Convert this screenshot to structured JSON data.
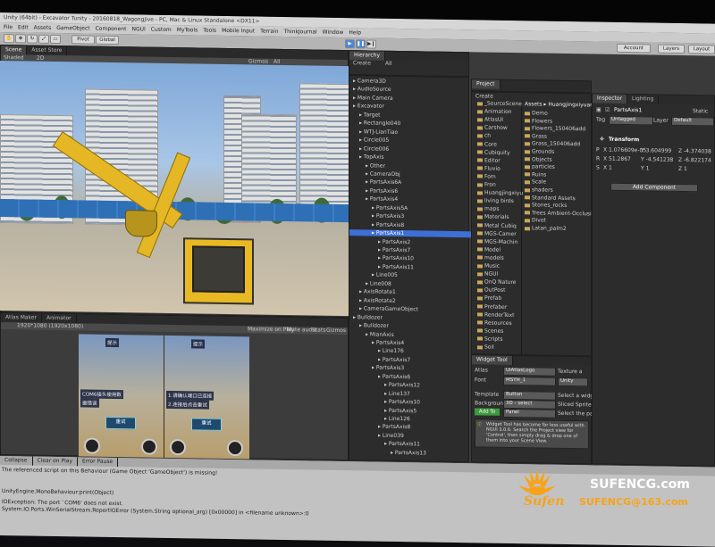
{
  "window": {
    "title": "Unity (64bit) - Excavator Tunity - 20160818_Wagongjive - PC, Mac & Linux Standalone <DX11>"
  },
  "menu": [
    "File",
    "Edit",
    "Assets",
    "GameObject",
    "Component",
    "NGUI",
    "Custom",
    "MyTools",
    "Tools",
    "Mobile Input",
    "Terrain",
    "ThinkJournal",
    "Window",
    "Help"
  ],
  "toolbar": {
    "pivot": "Pivot",
    "global": "Global",
    "account": "Account",
    "layers": "Layers",
    "layout": "Layout"
  },
  "scene_panel": {
    "tabs": [
      "Scene",
      "Asset Store"
    ],
    "shading": "Shaded",
    "mode_2d": "2D",
    "gizmos": "Gizmos",
    "search": "All"
  },
  "game_panel": {
    "tabs": [
      "Atlas Maker",
      "Animator"
    ],
    "resolution": "1920*1080 (1920x1080)",
    "toggles": [
      "Maximize on Play",
      "Mute audio",
      "Stats",
      "Gizmos"
    ],
    "screens": [
      {
        "sign": "提示",
        "retry": "重试",
        "note1": "COM6接头使用数",
        "note2": "据错误"
      },
      {
        "sign": "提示",
        "retry": "重试",
        "note1": "1.请确认端口已连接",
        "note2": "2.连接后点击重试"
      }
    ]
  },
  "console": {
    "buttons": [
      "Collapse",
      "Clear on Play",
      "Error Pause"
    ],
    "lines": [
      "The referenced script on this Behaviour (Game Object 'GameObject') is missing!",
      "UnityEngine.MonoBehaviour:print(Object)",
      "IOException: The port `COM6' does not exist.",
      "System.IO.Ports.WinSerialStream.ReportIOError (System.String optional_arg) [0x00000] in <filename unknown>:0"
    ]
  },
  "hierarchy": {
    "title": "Hierarchy",
    "create": "Create",
    "search": "All",
    "items": [
      {
        "label": "Camera3D",
        "depth": 0
      },
      {
        "label": "AudioSource",
        "depth": 0
      },
      {
        "label": "Main Camera",
        "depth": 0
      },
      {
        "label": "Excavator",
        "depth": 0
      },
      {
        "label": "Target",
        "depth": 1
      },
      {
        "label": "Rectangle040",
        "depth": 1
      },
      {
        "label": "WTJ-LianTiao",
        "depth": 1
      },
      {
        "label": "Circle005",
        "depth": 1
      },
      {
        "label": "Circle006",
        "depth": 1
      },
      {
        "label": "TopAxis",
        "depth": 1
      },
      {
        "label": "Other",
        "depth": 2
      },
      {
        "label": "CameraObj",
        "depth": 2
      },
      {
        "label": "PartsAxis6A",
        "depth": 2
      },
      {
        "label": "PartsAxis6",
        "depth": 2
      },
      {
        "label": "PartsAxis4",
        "depth": 2
      },
      {
        "label": "PartsAxis5A",
        "depth": 3
      },
      {
        "label": "PartsAxis3",
        "depth": 3
      },
      {
        "label": "PartsAxis8",
        "depth": 3
      },
      {
        "label": "PartsAxis1",
        "depth": 3,
        "selected": true
      },
      {
        "label": "PartsAxis2",
        "depth": 4
      },
      {
        "label": "PartsAxis7",
        "depth": 4
      },
      {
        "label": "PartsAxis10",
        "depth": 4
      },
      {
        "label": "PartsAxis11",
        "depth": 4
      },
      {
        "label": "Line005",
        "depth": 3
      },
      {
        "label": "Line008",
        "depth": 2
      },
      {
        "label": "AxisRotate1",
        "depth": 1
      },
      {
        "label": "AxisRotate2",
        "depth": 1
      },
      {
        "label": "CameraGameObject",
        "depth": 1
      },
      {
        "label": "Bulldozer",
        "depth": 0
      },
      {
        "label": "Bulldozer",
        "depth": 1
      },
      {
        "label": "MianAxis",
        "depth": 2
      },
      {
        "label": "PartsAxis4",
        "depth": 3
      },
      {
        "label": "Line176",
        "depth": 4
      },
      {
        "label": "PartsAxis7",
        "depth": 4
      },
      {
        "label": "PartsAxis3",
        "depth": 3
      },
      {
        "label": "PartsAxis6",
        "depth": 4
      },
      {
        "label": "PartsAxis12",
        "depth": 5
      },
      {
        "label": "Line137",
        "depth": 5
      },
      {
        "label": "PartsAxis10",
        "depth": 5
      },
      {
        "label": "PartsAxis5",
        "depth": 5
      },
      {
        "label": "Line126",
        "depth": 5
      },
      {
        "label": "PartsAxis8",
        "depth": 4
      },
      {
        "label": "Line039",
        "depth": 4
      },
      {
        "label": "PartsAxis11",
        "depth": 5
      },
      {
        "label": "PartsAxis13",
        "depth": 6
      }
    ]
  },
  "project": {
    "title": "Project",
    "create": "Create",
    "breadcrumb": "Assets ▸ Huangjingxiyuanba",
    "folders": [
      "_SourceScene",
      "Animation",
      "AtlasUI",
      "Carshow",
      "ch",
      "Core",
      "Cubiquity",
      "Editor",
      "Fluvio",
      "Fom",
      "Fron",
      "Huangjingxiyu",
      "living birds",
      "maps",
      "Materials",
      "Metal Cubiq",
      "MGS-Camer",
      "MGS-Machin",
      "Model",
      "models",
      "Music",
      "NGUI",
      "OnQ Nature",
      "OutPost",
      "Prefab",
      "Prefaber",
      "RenderText",
      "Resources",
      "Scenes",
      "Scripts",
      "Soil"
    ],
    "assets": [
      "Demo",
      "Flowers",
      "Flowers_150406add",
      "Grass",
      "Grass_150406add",
      "Grounds",
      "Objects",
      "particles",
      "Ruins",
      "Scale",
      "shaders",
      "Standard Assets",
      "Stones_rocks",
      "Trees Ambient-Occlusion",
      "Divot",
      "Latan_palm2"
    ]
  },
  "widget_tool": {
    "title": "Widget Tool",
    "atlas_label": "Atlas",
    "atlas_value": "UiAtlasLogo",
    "font_label": "Font",
    "font_value": "MSYH_1",
    "template_label": "Template",
    "template_value": "Button",
    "background_label": "Background",
    "background_value": "3D - select",
    "add_to": "Add To",
    "panel": "Panel",
    "texture_label": "Texture a",
    "unity_label": "Unity",
    "select_widget": "Select a widge",
    "sliced_sprite": "Sliced Sprite fo",
    "select_panel": "Select the par",
    "info": "Widget Tool has become far less useful with NGUI 3.0.6. Search the Project view for 'Control', then simply drag & drop one of them into your Scene View."
  },
  "inspector": {
    "tabs": [
      "Inspector",
      "Lighting"
    ],
    "object_name": "PartsAxis1",
    "static": "Static",
    "tag_label": "Tag",
    "tag_value": "Untagged",
    "layer_label": "Layer",
    "layer_value": "Default",
    "component": "Transform",
    "rows": [
      {
        "label": "P",
        "x": "X 1.076609e-05",
        "y": "Y 3.604999",
        "z": "Z -4.374038"
      },
      {
        "label": "R",
        "x": "X 51.2867",
        "y": "Y -4.541238",
        "z": "Z -6.822174"
      },
      {
        "label": "S",
        "x": "X 1",
        "y": "Y 1",
        "z": "Z 1"
      }
    ],
    "add_component": "Add Component"
  },
  "watermark": {
    "brand": "SUFENCG.com",
    "sufen": "Sufen",
    "email": "SUFENCG@163.com",
    "colors": {
      "orange": "#f6a31a",
      "white": "#ffffff"
    }
  }
}
